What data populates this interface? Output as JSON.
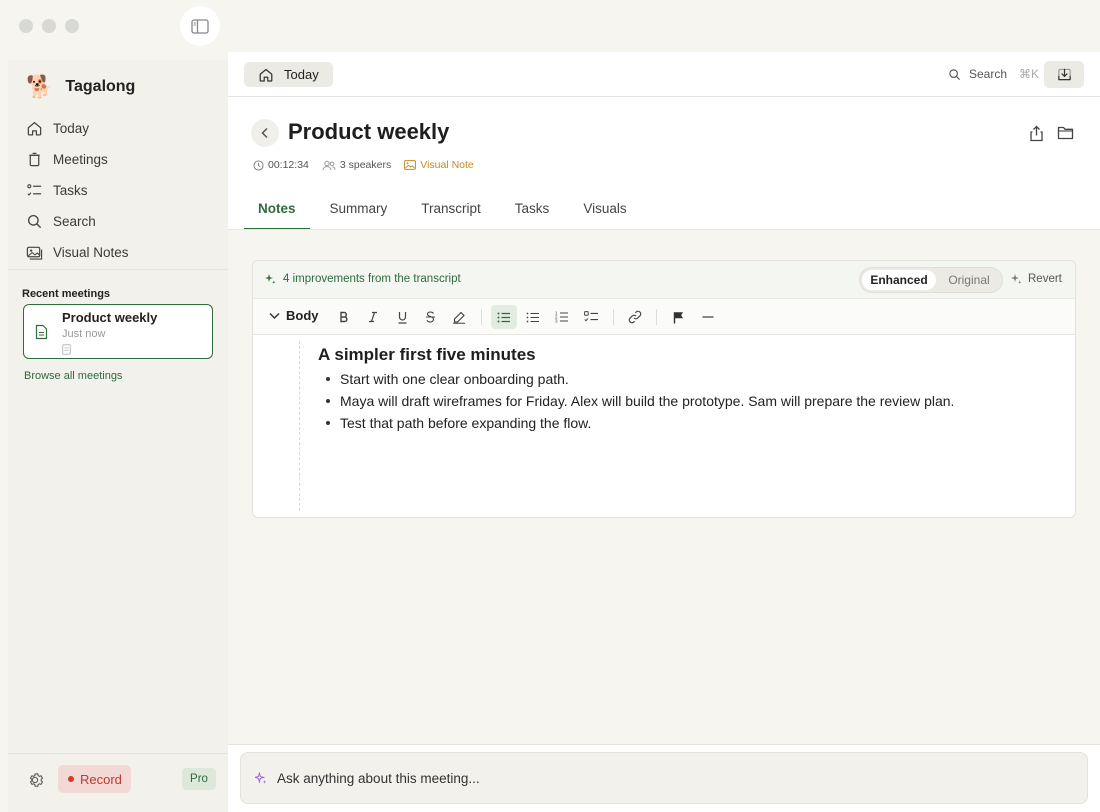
{
  "app": {
    "name": "Tagalong",
    "logo_glyph": "🐕"
  },
  "sidebar": {
    "nav": [
      {
        "label": "Today",
        "icon": "home-icon"
      },
      {
        "label": "Meetings",
        "icon": "trash-can-icon"
      },
      {
        "label": "Tasks",
        "icon": "checklist-icon"
      },
      {
        "label": "Search",
        "icon": "search-icon"
      },
      {
        "label": "Visual Notes",
        "icon": "images-icon"
      }
    ],
    "recent_title": "Recent meetings",
    "recent": [
      {
        "title": "Product weekly",
        "subtitle": "Just now"
      }
    ],
    "browse_label": "Browse all meetings",
    "record_label": "Record",
    "plan_badge": "Pro"
  },
  "topbar": {
    "today_label": "Today",
    "search_label": "Search",
    "search_shortcut": "⌘K"
  },
  "meeting": {
    "title": "Product weekly",
    "duration": "00:12:34",
    "speakers": "3 speakers",
    "visual_note": "Visual Note"
  },
  "tabs": [
    {
      "label": "Notes",
      "active": true
    },
    {
      "label": "Summary",
      "active": false
    },
    {
      "label": "Transcript",
      "active": false
    },
    {
      "label": "Tasks",
      "active": false
    },
    {
      "label": "Visuals",
      "active": false
    }
  ],
  "editor": {
    "improvements": "4 improvements from the transcript",
    "toggle": {
      "enhanced": "Enhanced",
      "original": "Original",
      "selected": "Enhanced"
    },
    "revert_label": "Revert",
    "block_style": "Body",
    "toolbar_buttons": [
      "bold-icon",
      "italic-icon",
      "underline-icon",
      "strikethrough-icon",
      "highlight-icon",
      "list-check-icon",
      "bullet-list-icon",
      "numbered-list-icon",
      "checklist-icon",
      "link-icon",
      "flag-icon",
      "divider-icon"
    ],
    "heading": "A simpler first five minutes",
    "bullets": [
      "Start with one clear onboarding path.",
      "Maya will draft wireframes for Friday. Alex will build the prototype. Sam will prepare the review plan.",
      "Test that path before expanding the flow."
    ]
  },
  "ask": {
    "placeholder": "Ask anything about this meeting..."
  },
  "colors": {
    "accent": "#2f6b3c",
    "record": "#d63a2b",
    "visual_note": "#c88a1e"
  }
}
